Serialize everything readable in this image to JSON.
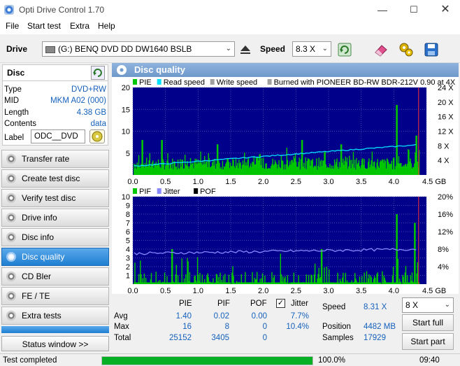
{
  "window": {
    "title": "Opti Drive Control 1.70"
  },
  "menu": [
    "File",
    "Start test",
    "Extra",
    "Help"
  ],
  "toolbar": {
    "drive_label": "Drive",
    "drive_value": "(G:)  BENQ DVD DD DW1640 BSLB",
    "speed_label": "Speed",
    "speed_value": "8.3 X"
  },
  "disc": {
    "header": "Disc",
    "rows": [
      {
        "k": "Type",
        "v": "DVD+RW"
      },
      {
        "k": "MID",
        "v": "MKM A02 (000)"
      },
      {
        "k": "Length",
        "v": "4.38 GB"
      },
      {
        "k": "Contents",
        "v": "data"
      }
    ],
    "label_key": "Label",
    "label_value": "ODC__DVD"
  },
  "nav": [
    "Transfer rate",
    "Create test disc",
    "Verify test disc",
    "Drive info",
    "Disc info",
    "Disc quality",
    "CD Bler",
    "FE / TE",
    "Extra tests"
  ],
  "status_window_btn": "Status window >>",
  "panel_title": "Disc quality",
  "chart_data": [
    {
      "type": "bar",
      "legend": [
        "PIE",
        "Read speed",
        "Write speed",
        "Burned with PIONEER BD-RW   BDR-212V 0.90 at 4X"
      ],
      "colors": {
        "pie": "#00c800",
        "read": "#00e0ff",
        "write": "#a0a0a0",
        "bg": "#00008b"
      },
      "x_ticks": [
        "0.0",
        "0.5",
        "1.0",
        "1.5",
        "2.0",
        "2.5",
        "3.0",
        "3.5",
        "4.0",
        "4.5 GB"
      ],
      "y_left_ticks": [
        "20",
        "15",
        "10",
        "5"
      ],
      "y_right_ticks": [
        "24 X",
        "20 X",
        "16 X",
        "12 X",
        "8 X",
        "4 X"
      ],
      "xlim": [
        0,
        4.5
      ],
      "ylim": [
        0,
        20
      ],
      "read_speed_start": 2.4,
      "read_speed_end": 8.3,
      "pie_peaks": [
        {
          "x": 0.15,
          "y": 8
        },
        {
          "x": 0.45,
          "y": 8
        },
        {
          "x": 1.3,
          "y": 7
        },
        {
          "x": 2.6,
          "y": 8
        },
        {
          "x": 3.2,
          "y": 7
        },
        {
          "x": 4.05,
          "y": 16
        },
        {
          "x": 4.35,
          "y": 9
        }
      ]
    },
    {
      "type": "bar",
      "legend": [
        "PIF",
        "Jitter",
        "POF"
      ],
      "colors": {
        "pif": "#00c800",
        "jitter": "#8888ff",
        "pof": "#000000"
      },
      "x_ticks": [
        "0.0",
        "0.5",
        "1.0",
        "1.5",
        "2.0",
        "2.5",
        "3.0",
        "3.5",
        "4.0",
        "4.5 GB"
      ],
      "y_left_ticks": [
        "10",
        "9",
        "8",
        "7",
        "6",
        "5",
        "4",
        "3",
        "2",
        "1"
      ],
      "y_right_ticks": [
        "20%",
        "16%",
        "12%",
        "8%",
        "4%"
      ],
      "xlim": [
        0,
        4.5
      ],
      "ylim": [
        0,
        10
      ],
      "jitter_start": 7.0,
      "jitter_end": 8.0,
      "pif_peaks": [
        {
          "x": 4.05,
          "y": 8
        },
        {
          "x": 4.32,
          "y": 7
        },
        {
          "x": 0.6,
          "y": 4
        },
        {
          "x": 2.9,
          "y": 4
        }
      ]
    }
  ],
  "stats": {
    "headers": [
      "PIE",
      "PIF",
      "POF",
      "Jitter"
    ],
    "rows": [
      {
        "k": "Avg",
        "v": [
          "1.40",
          "0.02",
          "0.00",
          "7.7%"
        ]
      },
      {
        "k": "Max",
        "v": [
          "16",
          "8",
          "0",
          "10.4%"
        ]
      },
      {
        "k": "Total",
        "v": [
          "25152",
          "3405",
          "0",
          ""
        ]
      }
    ],
    "speed_label": "Speed",
    "speed_value": "8.31 X",
    "position_label": "Position",
    "position_value": "4482 MB",
    "samples_label": "Samples",
    "samples_value": "17929",
    "speed_select": "8 X",
    "start_full": "Start full",
    "start_part": "Start part"
  },
  "status": {
    "text": "Test completed",
    "progress": 100,
    "percent": "100.0%",
    "time": "09:40"
  }
}
